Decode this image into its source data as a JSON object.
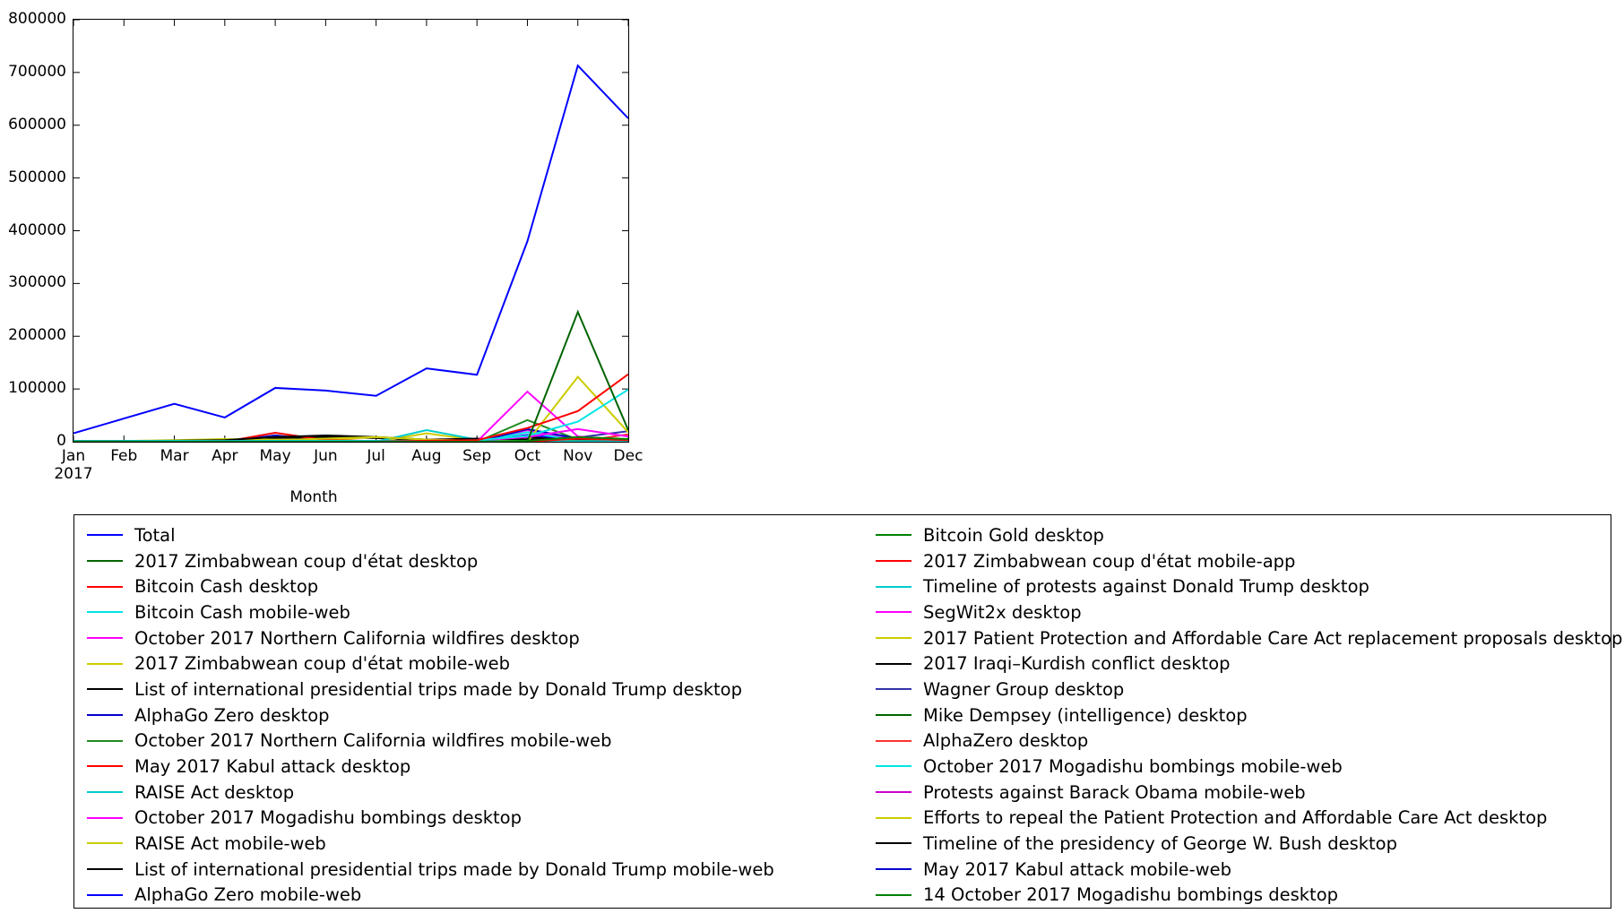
{
  "chart_data": {
    "type": "line",
    "title": "",
    "xlabel": "Month",
    "ylabel": "",
    "grid": false,
    "legend_position": "below-two-columns",
    "x": [
      "Jan",
      "Feb",
      "Mar",
      "Apr",
      "May",
      "Jun",
      "Jul",
      "Aug",
      "Sep",
      "Oct",
      "Nov",
      "Dec"
    ],
    "x_sublabel": "2017",
    "xtick_labels": [
      "Jan",
      "Feb",
      "Mar",
      "Apr",
      "May",
      "Jun",
      "Jul",
      "Aug",
      "Sep",
      "Oct",
      "Nov",
      "Dec"
    ],
    "ytick_labels": [
      "0",
      "100000",
      "200000",
      "300000",
      "400000",
      "500000",
      "600000",
      "700000",
      "800000"
    ],
    "ylim": [
      0,
      800000
    ],
    "ytick_step": 100000,
    "series": [
      {
        "name": "Total",
        "color": "#0000ff",
        "values": [
          16000,
          44000,
          72000,
          46000,
          102000,
          97000,
          87000,
          139000,
          127000,
          380000,
          713000,
          613000
        ]
      },
      {
        "name": "Bitcoin Gold desktop",
        "color": "#008000",
        "values": [
          0,
          0,
          0,
          0,
          0,
          0,
          0,
          0,
          0,
          1500,
          9000,
          5000
        ]
      },
      {
        "name": "2017 Zimbabwean coup d'état desktop",
        "color": "#006400",
        "values": [
          0,
          0,
          0,
          0,
          0,
          0,
          0,
          0,
          0,
          0,
          246000,
          22000
        ]
      },
      {
        "name": "2017 Zimbabwean coup d'état mobile-app",
        "color": "#ff0000",
        "values": [
          0,
          0,
          0,
          0,
          0,
          0,
          0,
          0,
          0,
          0,
          6000,
          3000
        ]
      },
      {
        "name": "Bitcoin Cash desktop",
        "color": "#ff0000",
        "values": [
          0,
          0,
          0,
          0,
          0,
          0,
          0,
          2000,
          3000,
          26000,
          58000,
          128000
        ]
      },
      {
        "name": "Timeline of protests against Donald Trump desktop",
        "color": "#00cccc",
        "values": [
          1200,
          1400,
          1600,
          1500,
          1600,
          1800,
          1500,
          1400,
          1300,
          1200,
          1100,
          1000
        ]
      },
      {
        "name": "Bitcoin Cash mobile-web",
        "color": "#00e5e5",
        "values": [
          0,
          0,
          0,
          0,
          0,
          0,
          0,
          1500,
          3000,
          11000,
          38000,
          99000
        ]
      },
      {
        "name": "SegWit2x desktop",
        "color": "#ff00ff",
        "values": [
          0,
          0,
          0,
          0,
          0,
          0,
          0,
          1000,
          2000,
          9000,
          24000,
          10000
        ]
      },
      {
        "name": "October 2017 Northern California wildfires desktop",
        "color": "#ff00ff",
        "values": [
          0,
          0,
          0,
          0,
          0,
          0,
          0,
          0,
          0,
          95000,
          10000,
          3000
        ]
      },
      {
        "name": "2017 Patient Protection and Affordable Care Act replacement proposals desktop",
        "color": "#cccc00",
        "values": [
          0,
          0,
          0,
          0,
          3000,
          6000,
          9000,
          4000,
          2000,
          1500,
          1200,
          900
        ]
      },
      {
        "name": "2017 Zimbabwean coup d'état mobile-web",
        "color": "#cccc00",
        "values": [
          0,
          0,
          0,
          0,
          0,
          0,
          0,
          0,
          0,
          0,
          123000,
          18000
        ]
      },
      {
        "name": "2017 Iraqi–Kurdish conflict desktop",
        "color": "#000000",
        "values": [
          0,
          0,
          0,
          0,
          0,
          0,
          0,
          1000,
          4000,
          8000,
          3000,
          1500
        ]
      },
      {
        "name": "List of international presidential trips made by Donald Trump desktop",
        "color": "#000000",
        "values": [
          1000,
          1400,
          2000,
          3000,
          9000,
          12000,
          9000,
          4000,
          6000,
          4000,
          3000,
          2500
        ]
      },
      {
        "name": "Wagner Group desktop",
        "color": "#3333aa",
        "values": [
          300,
          400,
          500,
          600,
          900,
          1200,
          1400,
          1200,
          1000,
          2500,
          8000,
          20000
        ]
      },
      {
        "name": "AlphaGo Zero desktop",
        "color": "#0000cc",
        "values": [
          0,
          0,
          0,
          0,
          0,
          0,
          0,
          0,
          0,
          24000,
          6000,
          2500
        ]
      },
      {
        "name": "Mike Dempsey (intelligence) desktop",
        "color": "#006400",
        "values": [
          200,
          250,
          300,
          300,
          400,
          500,
          400,
          350,
          300,
          400,
          1200,
          900
        ]
      },
      {
        "name": "October 2017 Northern California wildfires mobile-web",
        "color": "#228b22",
        "values": [
          0,
          0,
          0,
          0,
          0,
          0,
          0,
          0,
          0,
          41000,
          4000,
          1500
        ]
      },
      {
        "name": "AlphaZero desktop",
        "color": "#ff3333",
        "values": [
          0,
          0,
          0,
          0,
          0,
          0,
          0,
          0,
          0,
          0,
          0,
          14000
        ]
      },
      {
        "name": "May 2017 Kabul attack desktop",
        "color": "#ff0000",
        "values": [
          0,
          0,
          0,
          0,
          17000,
          3000,
          1200,
          800,
          600,
          500,
          400,
          300
        ]
      },
      {
        "name": "October 2017 Mogadishu bombings mobile-web",
        "color": "#00e5e5",
        "values": [
          0,
          0,
          0,
          0,
          0,
          0,
          0,
          0,
          0,
          18000,
          2000,
          800
        ]
      },
      {
        "name": "RAISE Act desktop",
        "color": "#00cccc",
        "values": [
          0,
          0,
          0,
          0,
          0,
          0,
          0,
          22000,
          4000,
          1500,
          900,
          600
        ]
      },
      {
        "name": "Protests against Barack Obama mobile-web",
        "color": "#cc00cc",
        "values": [
          900,
          1000,
          1100,
          1200,
          1100,
          1000,
          900,
          1000,
          900,
          1200,
          1100,
          1000
        ]
      },
      {
        "name": "October 2017 Mogadishu bombings desktop",
        "color": "#ff00ff",
        "values": [
          0,
          0,
          0,
          0,
          0,
          0,
          0,
          0,
          0,
          22000,
          2500,
          1000
        ]
      },
      {
        "name": "Efforts to repeal the Patient Protection and Affordable Care Act desktop",
        "color": "#cccc00",
        "values": [
          1000,
          1500,
          3000,
          5000,
          4000,
          3000,
          9000,
          4000,
          2000,
          1500,
          1000,
          800
        ]
      },
      {
        "name": "RAISE Act mobile-web",
        "color": "#cccc00",
        "values": [
          0,
          0,
          0,
          0,
          0,
          0,
          0,
          16000,
          3000,
          1200,
          800,
          500
        ]
      },
      {
        "name": "Timeline of the presidency of George W. Bush desktop",
        "color": "#000000",
        "values": [
          1500,
          1600,
          1700,
          1600,
          1500,
          1400,
          1300,
          1400,
          1500,
          1400,
          1300,
          1200
        ]
      },
      {
        "name": "List of international presidential trips made by Donald Trump mobile-web",
        "color": "#000000",
        "values": [
          800,
          1000,
          1500,
          2500,
          7000,
          9000,
          7000,
          3000,
          4000,
          3000,
          2000,
          1800
        ]
      },
      {
        "name": "May 2017 Kabul attack mobile-web",
        "color": "#0000cc",
        "values": [
          0,
          0,
          0,
          0,
          12000,
          2000,
          900,
          600,
          500,
          400,
          350,
          300
        ]
      },
      {
        "name": "AlphaGo Zero mobile-web",
        "color": "#0000ff",
        "values": [
          0,
          0,
          0,
          0,
          0,
          0,
          0,
          0,
          0,
          13000,
          3000,
          1500
        ]
      },
      {
        "name": "14 October 2017 Mogadishu bombings desktop",
        "color": "#008000",
        "values": [
          0,
          0,
          0,
          0,
          0,
          0,
          0,
          0,
          0,
          11000,
          1500,
          700
        ]
      }
    ]
  },
  "legend": {
    "left_column": [
      {
        "label": "Total",
        "color": "#0000ff"
      },
      {
        "label": "2017 Zimbabwean coup d'état desktop",
        "color": "#006400"
      },
      {
        "label": "Bitcoin Cash desktop",
        "color": "#ff0000"
      },
      {
        "label": "Bitcoin Cash mobile-web",
        "color": "#00e5e5"
      },
      {
        "label": "October 2017 Northern California wildfires desktop",
        "color": "#ff00ff"
      },
      {
        "label": "2017 Zimbabwean coup d'état mobile-web",
        "color": "#cccc00"
      },
      {
        "label": "List of international presidential trips made by Donald Trump desktop",
        "color": "#000000"
      },
      {
        "label": "AlphaGo Zero desktop",
        "color": "#0000cc"
      },
      {
        "label": "October 2017 Northern California wildfires mobile-web",
        "color": "#228b22"
      },
      {
        "label": "May 2017 Kabul attack desktop",
        "color": "#ff0000"
      },
      {
        "label": "RAISE Act desktop",
        "color": "#00cccc"
      },
      {
        "label": "October 2017 Mogadishu bombings desktop",
        "color": "#ff00ff"
      },
      {
        "label": "RAISE Act mobile-web",
        "color": "#cccc00"
      },
      {
        "label": "List of international presidential trips made by Donald Trump mobile-web",
        "color": "#000000"
      },
      {
        "label": "AlphaGo Zero mobile-web",
        "color": "#0000ff"
      }
    ],
    "right_column": [
      {
        "label": "Bitcoin Gold desktop",
        "color": "#008000"
      },
      {
        "label": "2017 Zimbabwean coup d'état mobile-app",
        "color": "#ff0000"
      },
      {
        "label": "Timeline of protests against Donald Trump desktop",
        "color": "#00cccc"
      },
      {
        "label": "SegWit2x desktop",
        "color": "#ff00ff"
      },
      {
        "label": "2017 Patient Protection and Affordable Care Act replacement proposals desktop",
        "color": "#cccc00"
      },
      {
        "label": "2017 Iraqi–Kurdish conflict desktop",
        "color": "#000000"
      },
      {
        "label": "Wagner Group desktop",
        "color": "#3333aa"
      },
      {
        "label": "Mike Dempsey (intelligence) desktop",
        "color": "#006400"
      },
      {
        "label": "AlphaZero desktop",
        "color": "#ff3333"
      },
      {
        "label": "October 2017 Mogadishu bombings mobile-web",
        "color": "#00e5e5"
      },
      {
        "label": "Protests against Barack Obama mobile-web",
        "color": "#cc00cc"
      },
      {
        "label": "Efforts to repeal the Patient Protection and Affordable Care Act desktop",
        "color": "#cccc00"
      },
      {
        "label": "Timeline of the presidency of George W. Bush desktop",
        "color": "#000000"
      },
      {
        "label": "May 2017 Kabul attack mobile-web",
        "color": "#0000cc"
      },
      {
        "label": "14 October 2017 Mogadishu bombings desktop",
        "color": "#008000"
      }
    ]
  }
}
